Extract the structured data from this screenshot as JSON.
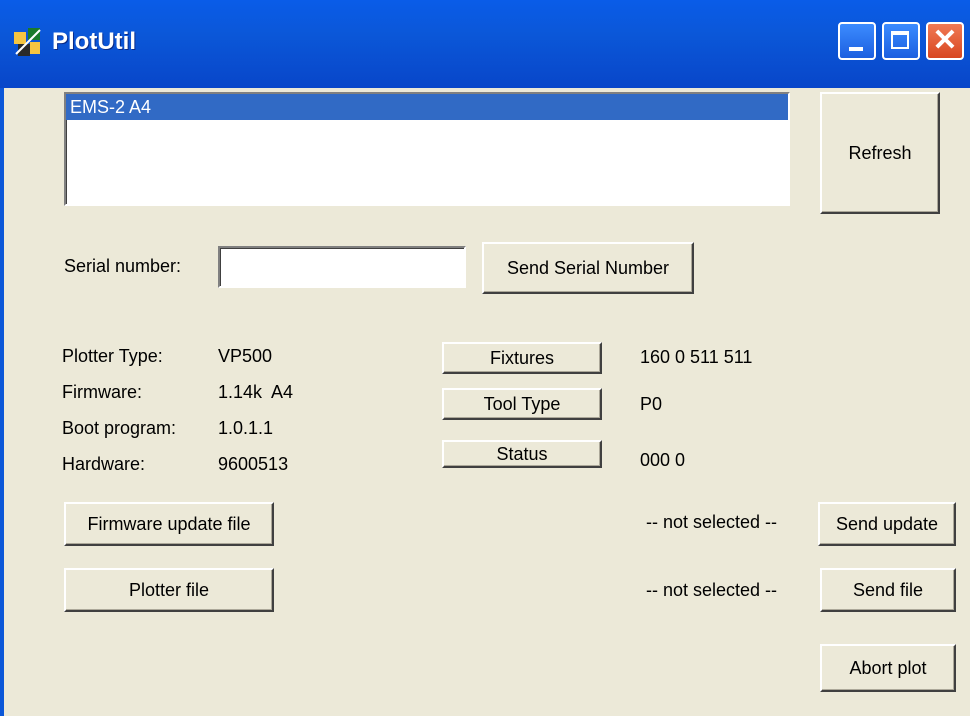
{
  "window": {
    "title": "PlotUtil"
  },
  "device_list": {
    "items": [
      "EMS-2 A4"
    ],
    "selected_index": 0
  },
  "buttons": {
    "refresh": "Refresh",
    "send_serial": "Send Serial Number",
    "fixtures": "Fixtures",
    "tool_type": "Tool Type",
    "status": "Status",
    "firmware_update_file": "Firmware update file",
    "send_update": "Send update",
    "plotter_file": "Plotter file",
    "send_file": "Send file",
    "abort_plot": "Abort plot"
  },
  "serial": {
    "label": "Serial number:",
    "value": ""
  },
  "info": {
    "plotter_type_label": "Plotter Type:",
    "plotter_type_value": "VP500",
    "firmware_label": "Firmware:",
    "firmware_value": "1.14k  A4",
    "boot_label": "Boot program:",
    "boot_value": "1.0.1.1",
    "hardware_label": "Hardware:",
    "hardware_value": "9600513"
  },
  "readouts": {
    "fixtures_value": "160 0 511 511",
    "tool_type_value": "P0",
    "status_value": "000 0"
  },
  "files": {
    "firmware_selected": "-- not selected --",
    "plotter_selected": "-- not selected --"
  },
  "colors": {
    "titlebar": "#0b57d8",
    "window_bg": "#ece9d8",
    "selection": "#316ac5"
  }
}
